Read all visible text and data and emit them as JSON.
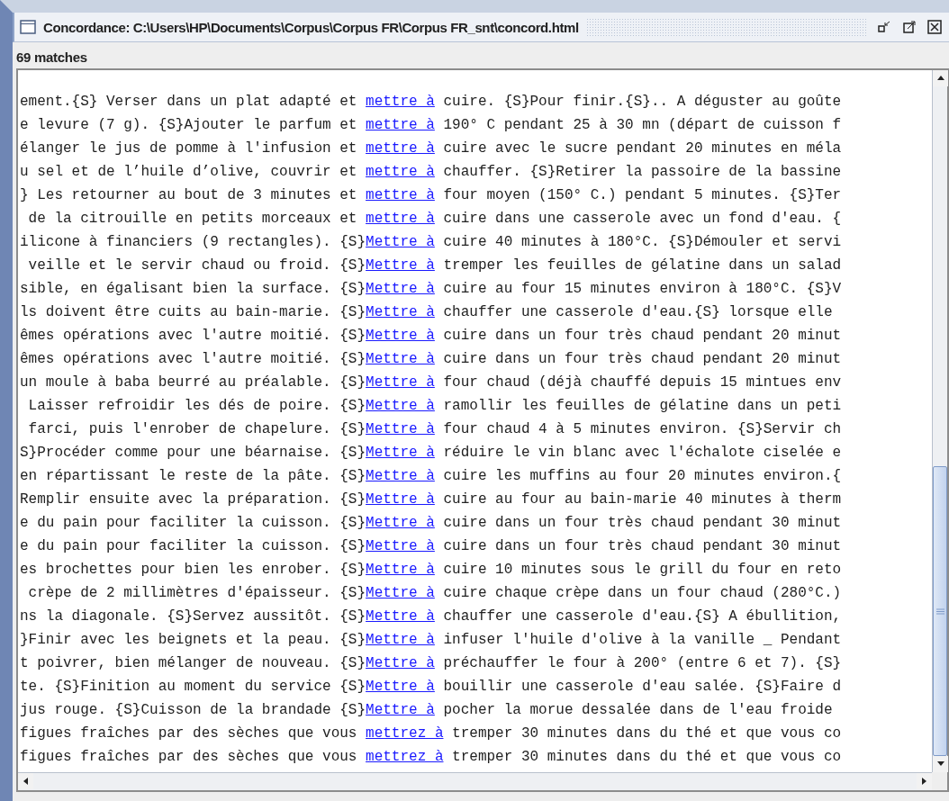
{
  "window": {
    "title": "Concordance: C:\\Users\\HP\\Documents\\Corpus\\Corpus FR\\Corpus FR_snt\\concord.html"
  },
  "match_count": "69 matches",
  "rows": [
    {
      "left": "ement.{S} Verser dans un plat adapté et ",
      "keyword": "mettre à",
      "right": " cuire. {S}Pour finir.{S}.. A déguster au goûte"
    },
    {
      "left": "e levure (7 g). {S}Ajouter le parfum et ",
      "keyword": "mettre à",
      "right": " 190° C pendant 25 à 30 mn (départ de cuisson f"
    },
    {
      "left": "élanger le jus de pomme à l'infusion et ",
      "keyword": "mettre à",
      "right": " cuire avec le sucre pendant 20 minutes en méla"
    },
    {
      "left": "u sel et de l’huile d’olive, couvrir et ",
      "keyword": "mettre à",
      "right": " chauffer. {S}Retirer la passoire de la bassine"
    },
    {
      "left": "} Les retourner au bout de 3 minutes et ",
      "keyword": "mettre à",
      "right": " four moyen (150° C.) pendant 5 minutes. {S}Ter"
    },
    {
      "left": " de la citrouille en petits morceaux et ",
      "keyword": "mettre à",
      "right": " cuire dans une casserole avec un fond d'eau. {"
    },
    {
      "left": "ilicone à financiers (9 rectangles). {S}",
      "keyword": "Mettre à",
      "right": " cuire 40 minutes à 180°C. {S}Démouler et servi"
    },
    {
      "left": " veille et le servir chaud ou froid. {S}",
      "keyword": "Mettre à",
      "right": " tremper les feuilles de gélatine dans un salad"
    },
    {
      "left": "sible, en égalisant bien la surface. {S}",
      "keyword": "Mettre à",
      "right": " cuire au four 15 minutes environ à 180°C. {S}V"
    },
    {
      "left": "ls doivent être cuits au bain-marie. {S}",
      "keyword": "Mettre à",
      "right": " chauffer une casserole d'eau.{S} lorsque elle"
    },
    {
      "left": "êmes opérations avec l'autre moitié. {S}",
      "keyword": "Mettre à",
      "right": " cuire dans un four très chaud pendant 20 minut"
    },
    {
      "left": "êmes opérations avec l'autre moitié. {S}",
      "keyword": "Mettre à",
      "right": " cuire dans un four très chaud pendant 20 minut"
    },
    {
      "left": "un moule à baba beurré au préalable. {S}",
      "keyword": "Mettre à",
      "right": " four chaud (déjà chauffé depuis 15 mintues env"
    },
    {
      "left": " Laisser refroidir les dés de poire. {S}",
      "keyword": "Mettre à",
      "right": " ramollir les feuilles de gélatine dans un peti"
    },
    {
      "left": " farci, puis l'enrober de chapelure. {S}",
      "keyword": "Mettre à",
      "right": " four chaud 4 à 5 minutes environ. {S}Servir ch"
    },
    {
      "left": "S}Procéder comme pour une béarnaise. {S}",
      "keyword": "Mettre à",
      "right": " réduire le vin blanc avec l'échalote ciselée e"
    },
    {
      "left": "en répartissant le reste de la pâte. {S}",
      "keyword": "Mettre à",
      "right": " cuire les muffins au four 20 minutes environ.{"
    },
    {
      "left": "Remplir ensuite avec la préparation. {S}",
      "keyword": "Mettre à",
      "right": " cuire au four au bain-marie 40 minutes à therm"
    },
    {
      "left": "e du pain pour faciliter la cuisson. {S}",
      "keyword": "Mettre à",
      "right": " cuire dans un four très chaud pendant 30 minut"
    },
    {
      "left": "e du pain pour faciliter la cuisson. {S}",
      "keyword": "Mettre à",
      "right": " cuire dans un four très chaud pendant 30 minut"
    },
    {
      "left": "es brochettes pour bien les enrober. {S}",
      "keyword": "Mettre à",
      "right": " cuire 10 minutes sous le grill du four en reto"
    },
    {
      "left": " crèpe de 2 millimètres d'épaisseur. {S}",
      "keyword": "Mettre à",
      "right": " cuire chaque crèpe dans un four chaud (280°C.)"
    },
    {
      "left": "ns la diagonale. {S}Servez aussitôt. {S}",
      "keyword": "Mettre à",
      "right": " chauffer une casserole d'eau.{S} A ébullition,"
    },
    {
      "left": "}Finir avec les beignets et la peau. {S}",
      "keyword": "Mettre à",
      "right": " infuser l'huile d'olive à la vanille _ Pendant"
    },
    {
      "left": "t poivrer, bien mélanger de nouveau. {S}",
      "keyword": "Mettre à",
      "right": " préchauffer le four à 200° (entre 6 et 7). {S}"
    },
    {
      "left": "te. {S}Finition au moment du service {S}",
      "keyword": "Mettre à",
      "right": " bouillir une casserole d'eau salée. {S}Faire d"
    },
    {
      "left": "jus rouge. {S}Cuisson de la brandade {S}",
      "keyword": "Mettre à",
      "right": " pocher la morue dessalée dans de l'eau froide"
    },
    {
      "left": "figues fraîches par des sèches que vous ",
      "keyword": "mettrez à",
      "right": " tremper 30 minutes dans du thé et que vous co"
    },
    {
      "left": "figues fraîches par des sèches que vous ",
      "keyword": "mettrez à",
      "right": " tremper 30 minutes dans du thé et que vous co"
    }
  ]
}
